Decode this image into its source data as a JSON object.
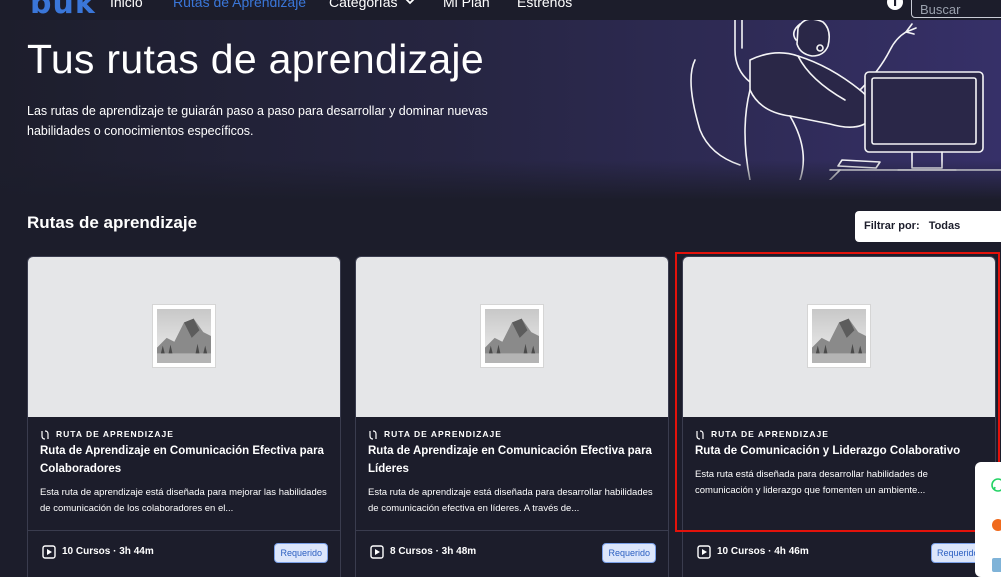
{
  "nav": {
    "logo": "buk",
    "items": [
      "Inicio",
      "Rutas de Aprendizaje",
      "Categorías",
      "Mi Plan",
      "Estrenos"
    ],
    "active_index": 1,
    "search_placeholder": "Buscar"
  },
  "hero": {
    "title": "Tus rutas de aprendizaje",
    "description": "Las rutas de aprendizaje te guiarán paso a paso para desarrollar y dominar nuevas habilidades o conocimientos específicos."
  },
  "section": {
    "title": "Rutas de aprendizaje",
    "filter_label": "Filtrar por:",
    "filter_value": "Todas"
  },
  "cards": [
    {
      "kicker": "RUTA DE APRENDIZAJE",
      "title": "Ruta de Aprendizaje en Comunicación Efectiva para Colaboradores",
      "description": "Esta ruta de aprendizaje está diseñada para mejorar las habilidades de comunicación de los colaboradores en el...",
      "meta": "10 Cursos · 3h 44m",
      "badge": "Requerido"
    },
    {
      "kicker": "RUTA DE APRENDIZAJE",
      "title": "Ruta de Aprendizaje en Comunicación Efectiva para Líderes",
      "description": "Esta ruta de aprendizaje está diseñada para desarrollar habilidades de comunicación efectiva en líderes. A través de...",
      "meta": "8 Cursos · 3h 48m",
      "badge": "Requerido"
    },
    {
      "kicker": "RUTA DE APRENDIZAJE",
      "title": "Ruta de Comunicación y Liderazgo Colaborativo",
      "description": "Esta ruta está diseñada para desarrollar habilidades de comunicación y liderazgo que fomenten un ambiente...",
      "meta": "10 Cursos · 4h 46m",
      "badge": "Requerido"
    }
  ],
  "colors": {
    "background": "#1c1d2b",
    "accent": "#3a76d8",
    "badge_bg": "#dce6fb",
    "highlight": "#e3120b"
  },
  "icons": [
    "chevron-down-icon",
    "info-icon",
    "route-icon",
    "play-icon",
    "whatsapp-icon"
  ]
}
